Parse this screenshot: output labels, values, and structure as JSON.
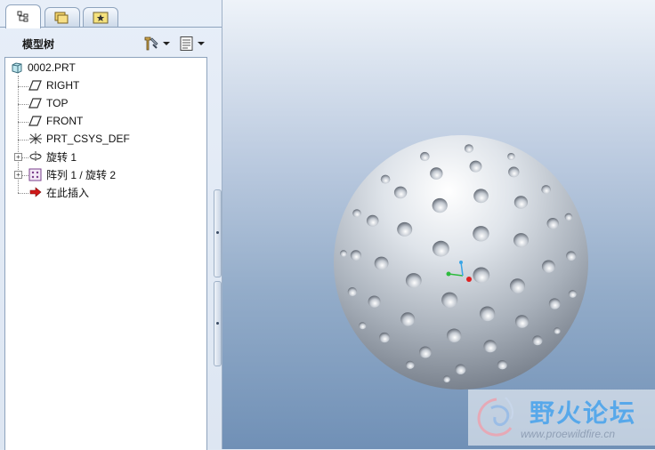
{
  "tabs": [
    {
      "name": "model-tree-tab",
      "icon": "model-tree-icon",
      "active": true
    },
    {
      "name": "folder-browser-tab",
      "icon": "folder-icon",
      "active": false
    },
    {
      "name": "favorites-tab",
      "icon": "favorites-icon",
      "active": false
    }
  ],
  "tree_header": {
    "title": "模型树",
    "settings_icon": "tree-settings-icon",
    "show_icon": "tree-columns-icon"
  },
  "tree": {
    "root": "0002.PRT",
    "items": [
      {
        "label": "RIGHT",
        "icon": "datum-plane-icon"
      },
      {
        "label": "TOP",
        "icon": "datum-plane-icon"
      },
      {
        "label": "FRONT",
        "icon": "datum-plane-icon"
      },
      {
        "label": "PRT_CSYS_DEF",
        "icon": "csys-icon"
      },
      {
        "label": "旋转 1",
        "icon": "revolve-icon",
        "expandable": true
      },
      {
        "label": "阵列 1 / 旋转 2",
        "icon": "pattern-icon",
        "expandable": true
      },
      {
        "label": "在此插入",
        "icon": "insert-here-arrow-icon"
      }
    ]
  },
  "watermark": {
    "text": "野火论坛",
    "url": "www.proewildfire.cn"
  },
  "colors": {
    "accent_blue": "#57a8ea",
    "viewport_top": "#eef3f9",
    "viewport_bottom": "#7090b6"
  }
}
